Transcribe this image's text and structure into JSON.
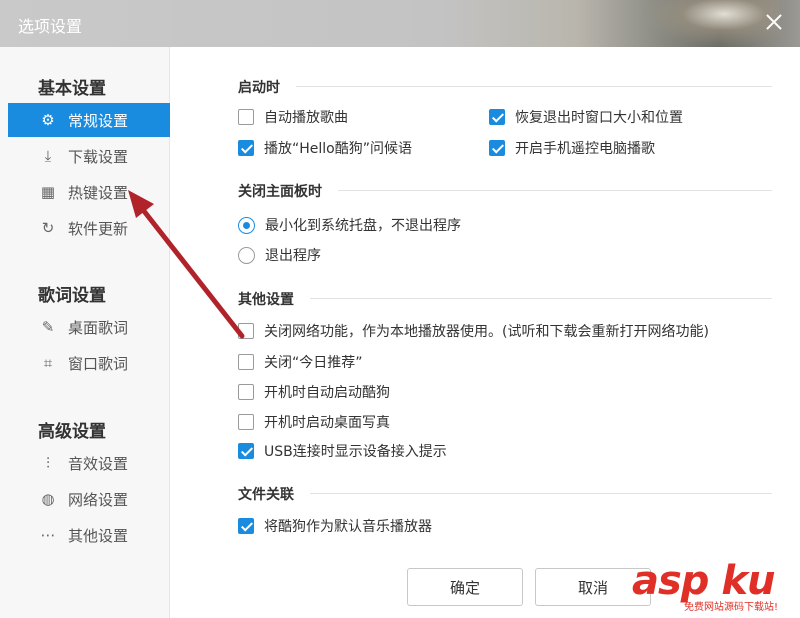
{
  "window": {
    "title": "选项设置"
  },
  "sidebar": {
    "groups": [
      {
        "title": "基本设置",
        "items": [
          {
            "label": "常规设置",
            "icon": "gear-icon",
            "glyph": "⚙",
            "active": true
          },
          {
            "label": "下载设置",
            "icon": "download-icon",
            "glyph": "⤓",
            "active": false
          },
          {
            "label": "热键设置",
            "icon": "keyboard-icon",
            "glyph": "▦",
            "active": false
          },
          {
            "label": "软件更新",
            "icon": "refresh-icon",
            "glyph": "↻",
            "active": false
          }
        ]
      },
      {
        "title": "歌词设置",
        "items": [
          {
            "label": "桌面歌词",
            "icon": "desktop-lyrics-icon",
            "glyph": "✎"
          },
          {
            "label": "窗口歌词",
            "icon": "window-lyrics-icon",
            "glyph": "⌗"
          }
        ]
      },
      {
        "title": "高级设置",
        "items": [
          {
            "label": "音效设置",
            "icon": "equalizer-icon",
            "glyph": "⫶"
          },
          {
            "label": "网络设置",
            "icon": "globe-icon",
            "glyph": "◍"
          },
          {
            "label": "其他设置",
            "icon": "more-icon",
            "glyph": "⋯"
          }
        ]
      }
    ]
  },
  "main": {
    "startup": {
      "title": "启动时",
      "auto_play": {
        "label": "自动播放歌曲",
        "checked": false
      },
      "restore_window": {
        "label": "恢复退出时窗口大小和位置",
        "checked": true
      },
      "play_hello": {
        "label": "播放“Hello酷狗”问候语",
        "checked": true
      },
      "phone_remote": {
        "label": "开启手机遥控电脑播歌",
        "checked": true
      }
    },
    "close_panel": {
      "title": "关闭主面板时",
      "minimize": {
        "label": "最小化到系统托盘，不退出程序",
        "selected": true
      },
      "exit": {
        "label": "退出程序",
        "selected": false
      }
    },
    "other": {
      "title": "其他设置",
      "disable_network": {
        "label": "关闭网络功能，作为本地播放器使用。(试听和下载会重新打开网络功能)",
        "checked": false
      },
      "disable_recommend": {
        "label": "关闭“今日推荐”",
        "checked": false
      },
      "autostart": {
        "label": "开机时自动启动酷狗",
        "checked": false
      },
      "desktop_photo": {
        "label": "开机时启动桌面写真",
        "checked": false
      },
      "usb_prompt": {
        "label": "USB连接时显示设备接入提示",
        "checked": true
      }
    },
    "file_assoc": {
      "title": "文件关联",
      "default_player": {
        "label": "将酷狗作为默认音乐播放器",
        "checked": true
      }
    }
  },
  "buttons": {
    "ok": "确定",
    "cancel": "取消"
  },
  "watermark": {
    "brand": "asp ku",
    "sub": "免费网站源码下载站!"
  },
  "colors": {
    "accent": "#1a8ce0",
    "arrow": "#b0232a"
  }
}
